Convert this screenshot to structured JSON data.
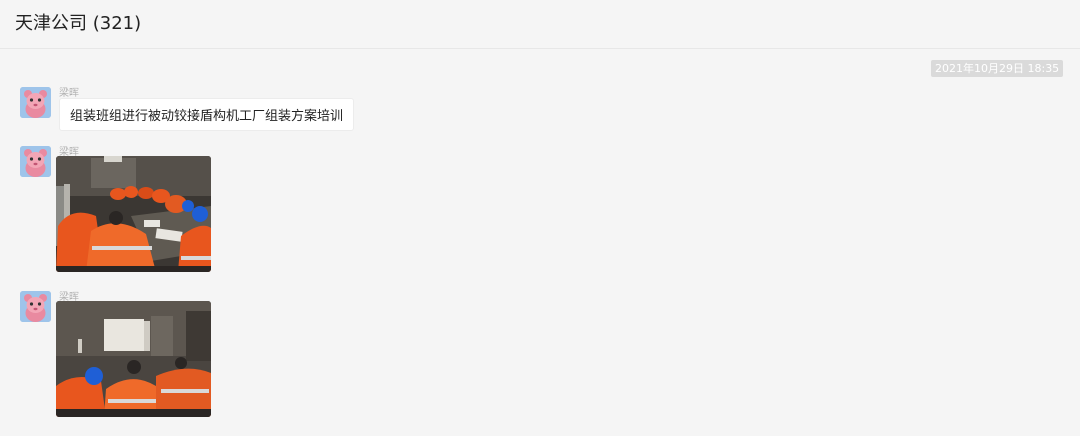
{
  "chat": {
    "title": "天津公司 (321)",
    "timestamp": "2021年10月29日 18:35"
  },
  "messages": [
    {
      "sender": "梁晖",
      "type": "text",
      "text": "组装班组进行被动铰接盾构机工厂组装方案培训"
    },
    {
      "sender": "梁晖",
      "type": "image",
      "image": "meeting-photo-1"
    },
    {
      "sender": "梁晖",
      "type": "image",
      "image": "meeting-photo-2"
    }
  ],
  "colors": {
    "background": "#f5f5f5",
    "bubble": "#ffffff",
    "timestamp_bg": "#dadada",
    "uniform_orange": "#e8561e",
    "helmet_blue": "#1f5fd6"
  }
}
